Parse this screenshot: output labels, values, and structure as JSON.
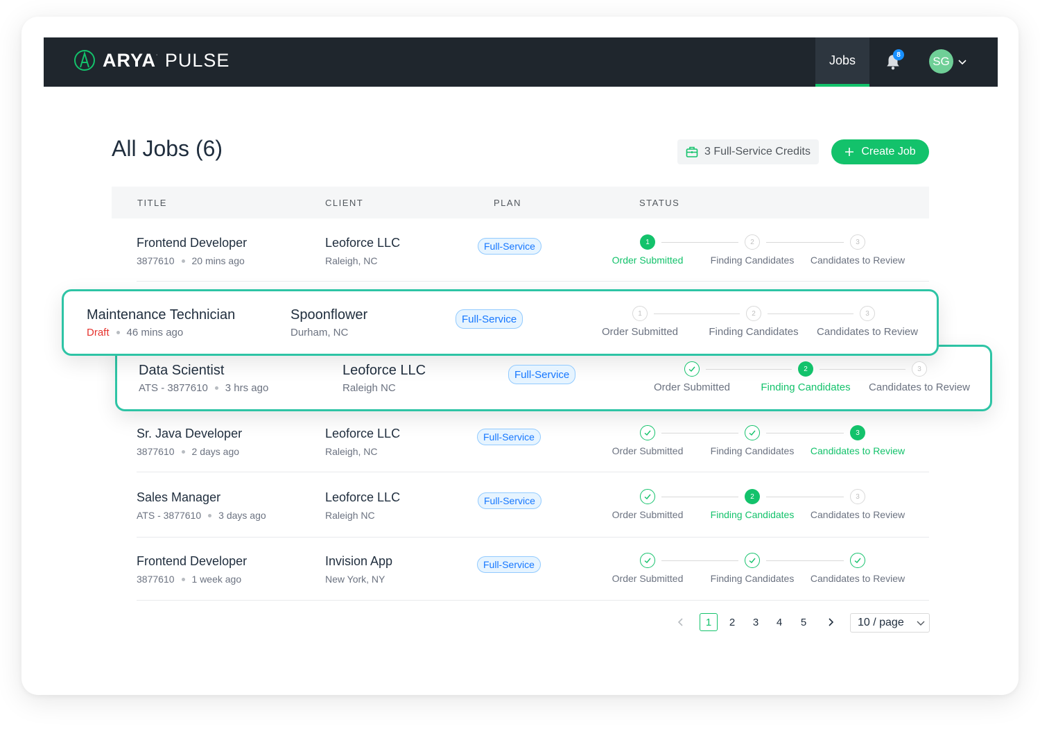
{
  "app": {
    "brand_bold": "ARYA",
    "brand_light": "PULSE"
  },
  "nav": {
    "jobs_label": "Jobs",
    "notification_count": "8",
    "avatar_initials": "SG"
  },
  "page": {
    "title": "All Jobs (6)",
    "credits_label": "3 Full-Service Credits",
    "create_label": "Create Job"
  },
  "table": {
    "headers": [
      "TITLE",
      "CLIENT",
      "PLAN",
      "STATUS"
    ],
    "step_labels": [
      "Order Submitted",
      "Finding Candidates",
      "Candidates to Review"
    ],
    "rows": [
      {
        "title": "Frontend Developer",
        "id": "3877610",
        "time": "20 mins ago",
        "client": "Leoforce LLC",
        "location": "Raleigh, NC",
        "plan": "Full-Service",
        "step_states": [
          "active",
          "pending",
          "pending"
        ]
      },
      {
        "title": "Maintenance Technician",
        "id": "Draft",
        "time": "46 mins ago",
        "client": "Spoonflower",
        "location": "Durham, NC",
        "plan": "Full-Service",
        "step_states": [
          "pending",
          "pending",
          "pending"
        ]
      },
      {
        "title": "Data Scientist",
        "id": "ATS - 3877610",
        "time": "3 hrs ago",
        "client": "Leoforce LLC",
        "location": "Raleigh NC",
        "plan": "Full-Service",
        "step_states": [
          "done",
          "active",
          "pending"
        ]
      },
      {
        "title": "Sr. Java Developer",
        "id": "3877610",
        "time": "2 days ago",
        "client": "Leoforce LLC",
        "location": "Raleigh, NC",
        "plan": "Full-Service",
        "step_states": [
          "done",
          "done",
          "active"
        ]
      },
      {
        "title": "Sales Manager",
        "id": "ATS - 3877610",
        "time": "3 days ago",
        "client": "Leoforce LLC",
        "location": "Raleigh NC",
        "plan": "Full-Service",
        "step_states": [
          "done",
          "active",
          "pending"
        ]
      },
      {
        "title": "Frontend Developer",
        "id": "3877610",
        "time": "1 week ago",
        "client": "Invision App",
        "location": "New York, NY",
        "plan": "Full-Service",
        "step_states": [
          "done",
          "done",
          "done"
        ]
      }
    ]
  },
  "pagination": {
    "pages": [
      "1",
      "2",
      "3",
      "4",
      "5"
    ],
    "current": "1",
    "page_size": "10 / page"
  },
  "colors": {
    "accent": "#13c26b",
    "highlight_border": "#2ec4a5",
    "navbar": "#1f262d",
    "draft": "#e5322d"
  }
}
